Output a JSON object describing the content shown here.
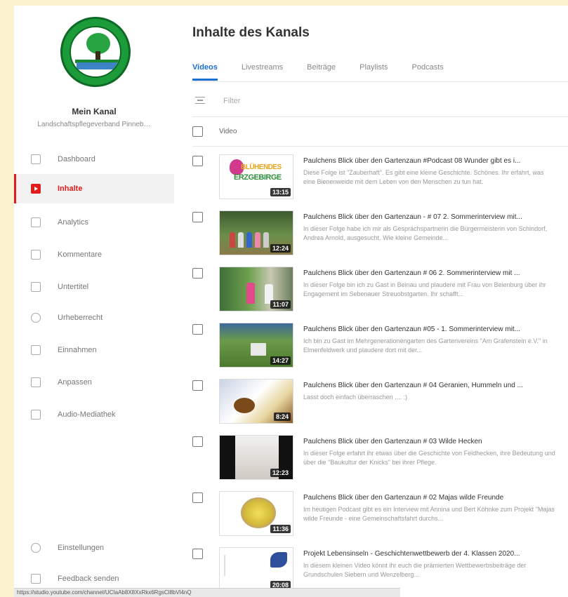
{
  "sidebar": {
    "channel_name": "Mein Kanal",
    "channel_subtitle": "Landschaftspflegeverband Pinneb…",
    "items": [
      {
        "label": "Dashboard",
        "icon": "dashboard-icon"
      },
      {
        "label": "Inhalte",
        "icon": "content-icon",
        "active": true
      },
      {
        "label": "Analytics",
        "icon": "analytics-icon"
      },
      {
        "label": "Kommentare",
        "icon": "comments-icon"
      },
      {
        "label": "Untertitel",
        "icon": "subtitles-icon"
      },
      {
        "label": "Urheberrecht",
        "icon": "copyright-icon"
      },
      {
        "label": "Einnahmen",
        "icon": "earn-icon"
      },
      {
        "label": "Anpassen",
        "icon": "customize-icon"
      },
      {
        "label": "Audio-Mediathek",
        "icon": "audio-library-icon"
      }
    ],
    "bottom_items": [
      {
        "label": "Einstellungen",
        "icon": "settings-icon"
      },
      {
        "label": "Feedback senden",
        "icon": "feedback-icon"
      }
    ]
  },
  "main": {
    "title": "Inhalte des Kanals",
    "tabs": [
      "Videos",
      "Livestreams",
      "Beiträge",
      "Playlists",
      "Podcasts"
    ],
    "filter_label": "Filter",
    "column_header": "Video",
    "videos": [
      {
        "title": "Paulchens Blick über den Gartenzaun #Podcast 08 Wunder gibt es i...",
        "description": "Diese Folge ist \"Zauberhaft\". Es gibt eine kleine Geschichte. Schönes. Ihr erfahrt, was eine Bienenweide mit dem Leben von den Menschen zu tun hat.",
        "duration": "13:15"
      },
      {
        "title": "Paulchens Blick über den Gartenzaun - # 07 2. Sommerinterview mit...",
        "description": "In dieser Folge habe ich mir als Gesprächspartnerin die Bürgermeisterin von Schindorf, Andrea Arnold, ausgesucht. Wie kleine Gemeinde...",
        "duration": "12:24"
      },
      {
        "title": "Paulchens Blick über den Gartenzaun # 06 2. Sommerinterview mit ...",
        "description": "In dieser Folge bin ich zu Gast in Beinau und plaudere mit Frau von Beienburg über ihr Engagement im Sebenauer Streuobstgarten. Ihr schafft...",
        "duration": "11:07"
      },
      {
        "title": "Paulchens Blick über den Gartenzaun #05 - 1. Sommerinterview mit...",
        "description": "Ich bin zu Gast im Mehrgenerationengarten des Gartenvereins \"Am Grafenstein e.V.\" in Elmenfeldwerk und plaudere dort mit der...",
        "duration": "14:27"
      },
      {
        "title": "Paulchens Blick über den Gartenzaun # 04 Geranien, Hummeln und ...",
        "description": "Lasst doch einfach überraschen .... :)",
        "duration": "8:24"
      },
      {
        "title": "Paulchens Blick über den Gartenzaun # 03 Wilde Hecken",
        "description": "In dieser Folge erfahrt ihr etwas über die Geschichte von Feldhecken, ihre Bedeutung und über die \"Baukultur der Knicks\" bei ihrer Pflege.",
        "duration": "12:23"
      },
      {
        "title": "Paulchens Blick über den Gartenzaun # 02 Majas wilde Freunde",
        "description": "Im heutigen Podcast gibt es ein Interview mit Annina und Bert Köhnke zum Projekt \"Majas wilde Freunde - eine Gemeinschaftsfahrt durchs...",
        "duration": "11:36"
      },
      {
        "title": "Projekt Lebensinseln - Geschichtenwettbewerb der 4. Klassen 2020...",
        "description": "In diesem kleinen Video könnt ihr euch die prämierten Wettbewerbsbeiträge der Grundschulen Siebern und Wenzelberg...",
        "duration": "20:08"
      }
    ]
  },
  "statusbar": {
    "url": "https://studio.youtube.com/channel/UCIaAb8X8XxRkx6RgsCl8bVl4nQ"
  },
  "colors": {
    "accent_red": "#e21b1b",
    "tab_blue": "#1a6fd1",
    "page_background": "#fbf3d0"
  }
}
